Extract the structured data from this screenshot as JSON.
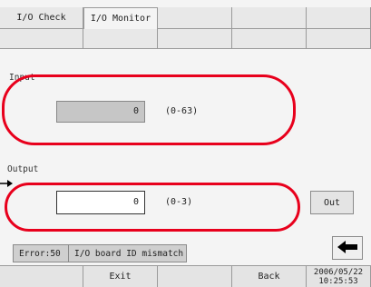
{
  "tabs": [
    {
      "label": "I/O Check",
      "active": false
    },
    {
      "label": "I/O Monitor",
      "active": true
    }
  ],
  "input": {
    "label": "Input",
    "value": "0",
    "range": "(0-63)"
  },
  "output": {
    "label": "Output",
    "value": "0",
    "range": "(0-3)",
    "out_button": "Out"
  },
  "status": {
    "error_code": "Error:50",
    "message": "I/O board ID mismatch"
  },
  "back_arrow_icon": "left-arrow-icon",
  "footer": {
    "exit_label": "Exit",
    "back_label": "Back",
    "date": "2006/05/22",
    "time": "10:25:53"
  },
  "colors": {
    "highlight": "#e8001c"
  }
}
